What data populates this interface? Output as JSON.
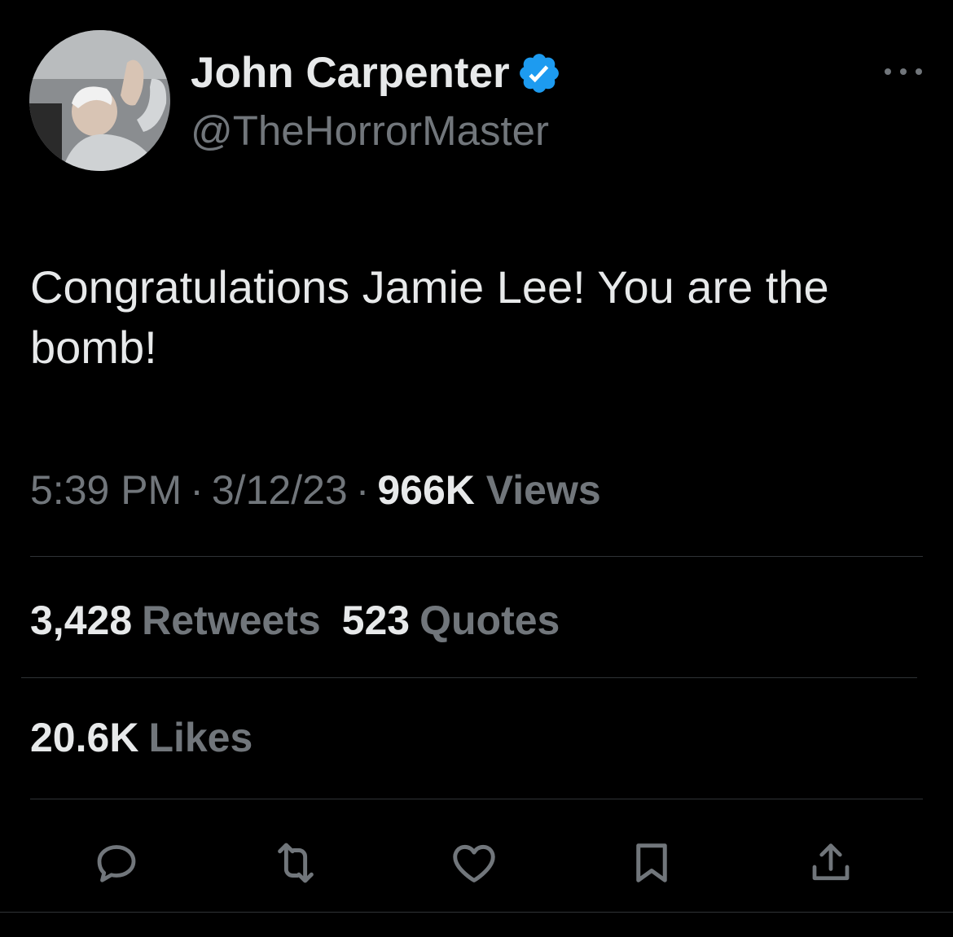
{
  "author": {
    "display_name": "John Carpenter",
    "handle": "@TheHorrorMaster",
    "verified": true
  },
  "tweet": {
    "text": "Congratulations Jamie Lee! You are the bomb!",
    "time": "5:39 PM",
    "date": "3/12/23",
    "views_count": "966K",
    "views_label": "Views",
    "separator": "·"
  },
  "stats": {
    "retweets_count": "3,428",
    "retweets_label": "Retweets",
    "quotes_count": "523",
    "quotes_label": "Quotes",
    "likes_count": "20.6K",
    "likes_label": "Likes"
  },
  "icons": {
    "more": "more-icon",
    "reply": "reply-icon",
    "retweet": "retweet-icon",
    "like": "heart-icon",
    "bookmark": "bookmark-icon",
    "share": "share-icon",
    "verified": "verified-badge-icon"
  },
  "colors": {
    "background": "#000000",
    "primary_text": "#e7e9ea",
    "secondary_text": "#71767b",
    "divider": "#2f3336",
    "verified_blue": "#1d9bf0"
  }
}
